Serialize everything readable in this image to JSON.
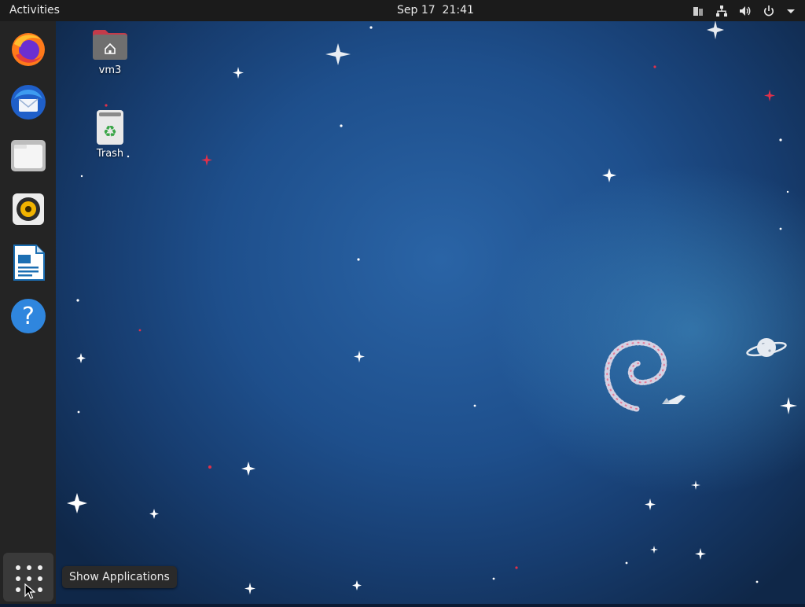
{
  "topbar": {
    "activities_label": "Activities",
    "clock": "Sep 17  21:41",
    "tray_icons": [
      "clipboard-icon",
      "network-icon",
      "volume-icon",
      "power-icon",
      "chevron-down-icon"
    ]
  },
  "dock": {
    "apps": [
      {
        "name": "Firefox",
        "icon": "firefox-icon"
      },
      {
        "name": "Thunderbird",
        "icon": "thunderbird-icon"
      },
      {
        "name": "Files",
        "icon": "files-icon"
      },
      {
        "name": "Rhythmbox",
        "icon": "rhythmbox-icon"
      },
      {
        "name": "LibreOffice Writer",
        "icon": "writer-icon"
      },
      {
        "name": "Help",
        "icon": "help-icon"
      }
    ],
    "show_apps_icon": "grid-icon"
  },
  "desktop": {
    "icons": [
      {
        "label": "vm3",
        "icon": "home-folder-icon"
      },
      {
        "label": "Trash",
        "icon": "trash-icon"
      }
    ]
  },
  "tooltip": {
    "text": "Show Applications"
  },
  "colors": {
    "accent_folder": "#c33b4a",
    "panel": "#1b1b1b",
    "dock": "#242424"
  }
}
